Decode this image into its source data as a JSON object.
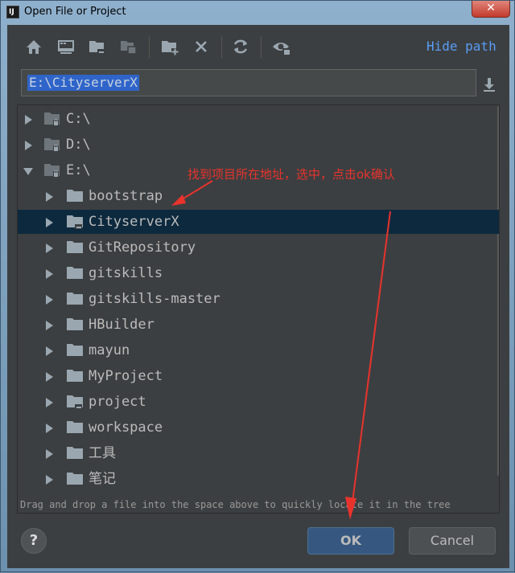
{
  "window": {
    "title": "Open File or Project",
    "close_glyph": "✕"
  },
  "toolbar": {
    "buttons": [
      "home-icon",
      "desktop-icon",
      "project-folder-icon",
      "module-folder-icon",
      "new-folder-icon",
      "delete-icon",
      "refresh-icon",
      "show-hidden-icon"
    ],
    "hide_path_label": "Hide path"
  },
  "path": {
    "value": "E:\\CityserverX"
  },
  "tree": {
    "drives": [
      {
        "label": "C:\\",
        "expanded": false
      },
      {
        "label": "D:\\",
        "expanded": false
      },
      {
        "label": "E:\\",
        "expanded": true
      }
    ],
    "folders": [
      {
        "label": "bootstrap",
        "project": false,
        "selected": false
      },
      {
        "label": "CityserverX",
        "project": true,
        "selected": true
      },
      {
        "label": "GitRepository",
        "project": false,
        "selected": false
      },
      {
        "label": "gitskills",
        "project": false,
        "selected": false
      },
      {
        "label": "gitskills-master",
        "project": false,
        "selected": false
      },
      {
        "label": "HBuilder",
        "project": false,
        "selected": false
      },
      {
        "label": "mayun",
        "project": false,
        "selected": false
      },
      {
        "label": "MyProject",
        "project": false,
        "selected": false
      },
      {
        "label": "project",
        "project": true,
        "selected": false
      },
      {
        "label": "workspace",
        "project": false,
        "selected": false
      },
      {
        "label": "工具",
        "project": false,
        "selected": false
      },
      {
        "label": "笔记",
        "project": false,
        "selected": false
      }
    ]
  },
  "hint": "Drag and drop a file into the space above to quickly locate it in the tree",
  "buttons": {
    "help": "?",
    "ok": "OK",
    "cancel": "Cancel"
  },
  "annotation": {
    "text": "找到项目所在地址，选中，点击ok确认"
  },
  "colors": {
    "selection": "#0d293e",
    "link": "#589df6",
    "annotation": "#e8332c",
    "background": "#3c3f41"
  }
}
